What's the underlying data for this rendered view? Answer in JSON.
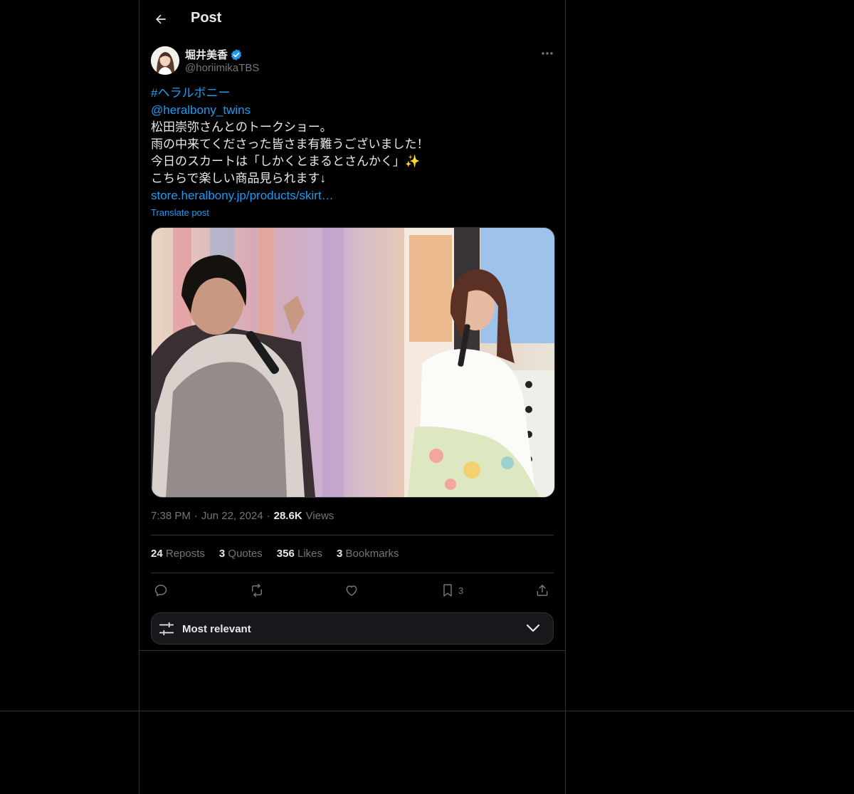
{
  "header": {
    "title": "Post"
  },
  "author": {
    "display_name": "堀井美香",
    "handle": "@horiimikaTBS",
    "verified": true
  },
  "tweet": {
    "hashtag": "#ヘラルボニー",
    "mention": "@heralbony_twins",
    "line1": "松田崇弥さんとのトークショー。",
    "line2": "雨の中来てくださった皆さま有難うございました！",
    "line3": "今日のスカートは「しかくとまるとさんかく」",
    "emoji": "✨",
    "line4": "こちらで楽しい商品見られます↓",
    "link": "store.heralbony.jp/products/skirt…",
    "translate": "Translate post"
  },
  "meta": {
    "time": "7:38 PM",
    "dot": "·",
    "date": "Jun 22, 2024",
    "views_count": "28.6K",
    "views_label": "Views"
  },
  "stats": {
    "reposts_count": "24",
    "reposts_label": "Reposts",
    "quotes_count": "3",
    "quotes_label": "Quotes",
    "likes_count": "356",
    "likes_label": "Likes",
    "bookmarks_count": "3",
    "bookmarks_label": "Bookmarks"
  },
  "actions": {
    "bookmark_count": "3"
  },
  "sort": {
    "label": "Most relevant"
  },
  "colors": {
    "background": "#000000",
    "accent": "#1d9bf0",
    "text": "#e7e9ea",
    "muted": "#71767b",
    "border": "#2f3336"
  }
}
